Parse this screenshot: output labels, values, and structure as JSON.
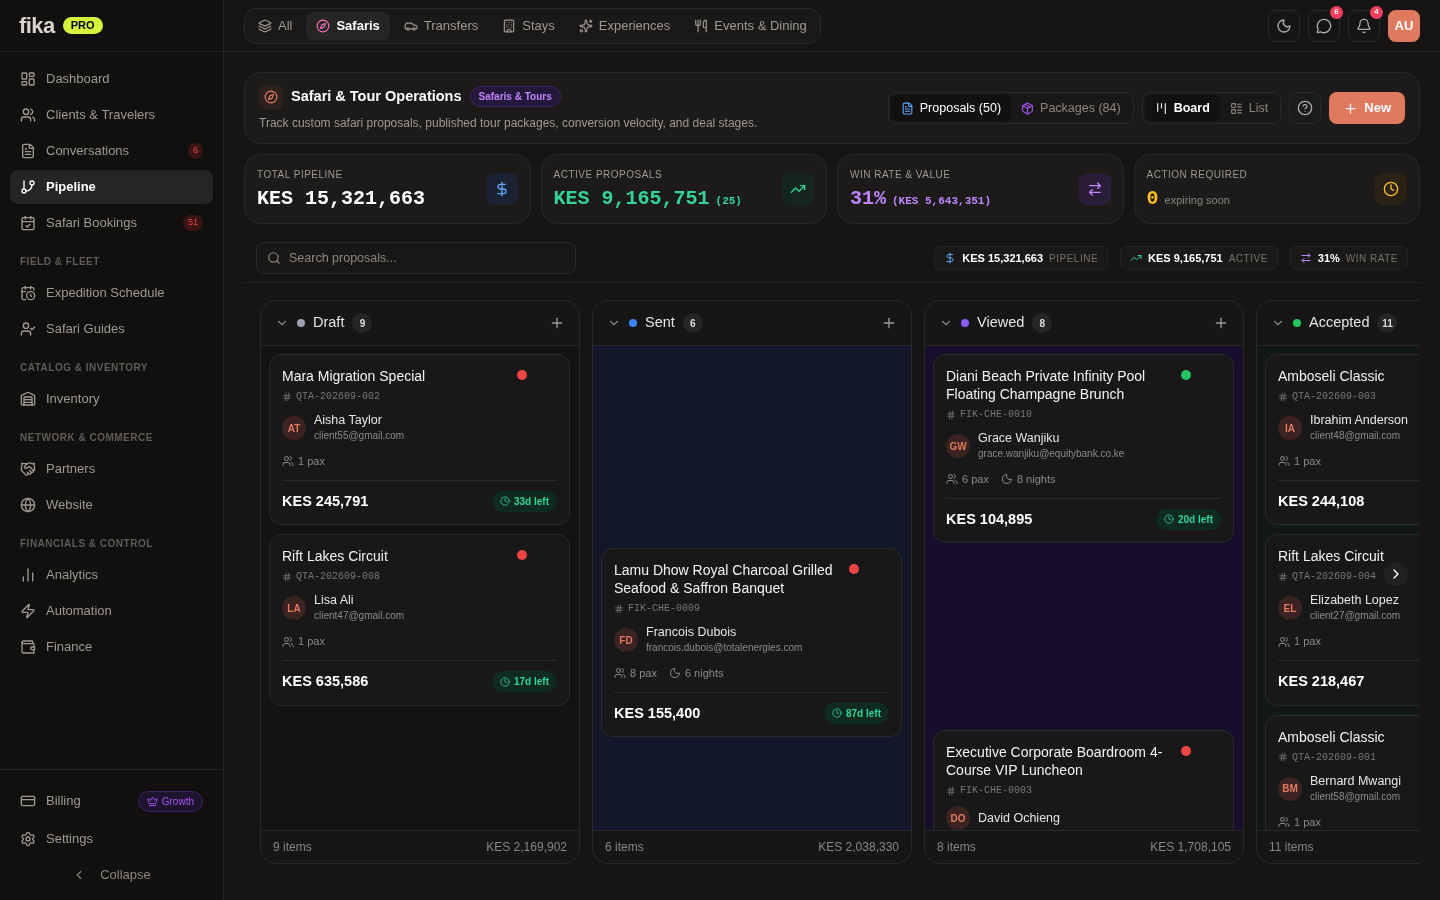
{
  "brand": {
    "name": "fika",
    "badge": "PRO"
  },
  "sidebar": {
    "groups": [
      {
        "items": [
          {
            "label": "Dashboard",
            "selected": false
          },
          {
            "label": "Clients & Travelers",
            "selected": false
          },
          {
            "label": "Conversations",
            "selected": false,
            "badge": "6"
          },
          {
            "label": "Pipeline",
            "selected": true
          },
          {
            "label": "Safari Bookings",
            "selected": false,
            "badge": "51"
          }
        ]
      },
      {
        "heading": "FIELD & FLEET",
        "items": [
          {
            "label": "Expedition Schedule",
            "selected": false
          },
          {
            "label": "Safari Guides",
            "selected": false
          }
        ]
      },
      {
        "heading": "CATALOG & INVENTORY",
        "items": [
          {
            "label": "Inventory",
            "selected": false
          }
        ]
      },
      {
        "heading": "NETWORK & COMMERCE",
        "items": [
          {
            "label": "Partners",
            "selected": false
          },
          {
            "label": "Website",
            "selected": false
          }
        ]
      },
      {
        "heading": "FINANCIALS & CONTROL",
        "items": [
          {
            "label": "Analytics",
            "selected": false
          },
          {
            "label": "Automation",
            "selected": false
          },
          {
            "label": "Finance",
            "selected": false
          }
        ]
      }
    ],
    "footer": {
      "billing": {
        "label": "Billing",
        "badge": "Growth"
      },
      "settings": "Settings",
      "collapse": "Collapse"
    }
  },
  "top_tabs": [
    {
      "label": "All",
      "selected": false
    },
    {
      "label": "Safaris",
      "selected": true
    },
    {
      "label": "Transfers",
      "selected": false
    },
    {
      "label": "Stays",
      "selected": false
    },
    {
      "label": "Experiences",
      "selected": false
    },
    {
      "label": "Events & Dining",
      "selected": false
    }
  ],
  "top_right": {
    "messages_badge": "6",
    "notifications_badge": "4",
    "avatar": "AU"
  },
  "header": {
    "title": "Safari & Tour Operations",
    "tag": "Safaris & Tours",
    "subtitle": "Track custom safari proposals, published tour packages, conversion velocity, and deal stages.",
    "sources": [
      {
        "label": "Proposals (50)",
        "selected": true
      },
      {
        "label": "Packages (84)",
        "selected": false
      }
    ],
    "views": [
      {
        "label": "Board",
        "selected": true
      },
      {
        "label": "List",
        "selected": false
      }
    ],
    "new_button": "New"
  },
  "stats": [
    {
      "label": "TOTAL PIPELINE",
      "value": "KES 15,321,663",
      "color": "#ffffff"
    },
    {
      "label": "ACTIVE PROPOSALS",
      "value": "KES 9,165,751",
      "extra": "(25)",
      "color": "#34d399"
    },
    {
      "label": "WIN RATE & VALUE",
      "value": "31%",
      "extra": "(KES 5,643,351)",
      "color": "#c084fc"
    },
    {
      "label": "ACTION REQUIRED",
      "value": "0",
      "note": "expiring soon",
      "color": "#fbbf24"
    }
  ],
  "search": {
    "placeholder": "Search proposals..."
  },
  "chips": [
    {
      "value": "KES 15,321,663",
      "label": "PIPELINE"
    },
    {
      "value": "KES 9,165,751",
      "label": "ACTIVE"
    },
    {
      "value": "31%",
      "label": "WIN RATE"
    }
  ],
  "columns": [
    {
      "title": "Draft",
      "count": "9",
      "color": "#9ca3af",
      "items_label": "9 items",
      "total": "KES 2,169,902",
      "cards": [
        {
          "title": "Mara Migration Special",
          "code": "QTA-202609-002",
          "initials": "AT",
          "name": "Aisha Taylor",
          "email": "client55@gmail.com",
          "pax": "1 pax",
          "amount": "KES 245,791",
          "due": "33d left",
          "color": "#ef4444"
        },
        {
          "title": "Rift Lakes Circuit",
          "code": "QTA-202609-008",
          "initials": "LA",
          "name": "Lisa Ali",
          "email": "client47@gmail.com",
          "pax": "1 pax",
          "amount": "KES 635,586",
          "due": "17d left",
          "color": "#ef4444"
        }
      ]
    },
    {
      "title": "Sent",
      "count": "6",
      "color": "#3b82f6",
      "items_label": "6 items",
      "total": "KES 2,038,330",
      "cards": [
        {
          "title": "Lamu Dhow Royal Charcoal Grilled Seafood & Saffron Banquet",
          "code": "FIK-CHE-0009",
          "initials": "FD",
          "name": "Francois Dubois",
          "email": "francois.dubois@totalenergies.com",
          "pax": "8 pax",
          "nights": "6 nights",
          "amount": "KES 155,400",
          "due": "87d left",
          "color": "#ef4444"
        }
      ]
    },
    {
      "title": "Viewed",
      "count": "8",
      "color": "#8b5cf6",
      "items_label": "8 items",
      "total": "KES 1,708,105",
      "cards": [
        {
          "title": "Diani Beach Private Infinity Pool Floating Champagne Brunch",
          "code": "FIK-CHE-0010",
          "initials": "GW",
          "name": "Grace Wanjiku",
          "email": "grace.wanjiku@equitybank.co.ke",
          "pax": "6 pax",
          "nights": "8 nights",
          "amount": "KES 104,895",
          "due": "20d left",
          "color": "#22c55e"
        },
        {
          "title": "Executive Corporate Boardroom 4-Course VIP Luncheon",
          "code": "FIK-CHE-0003",
          "initials": "DO",
          "name": "David Ochieng",
          "color": "#ef4444"
        }
      ]
    },
    {
      "title": "Accepted",
      "count": "11",
      "color": "#22c55e",
      "items_label": "11 items",
      "cards": [
        {
          "title": "Amboseli Classic",
          "code": "QTA-202609-003",
          "initials": "IA",
          "name": "Ibrahim Anderson",
          "email": "client48@gmail.com",
          "pax": "1 pax",
          "amount": "KES 244,108"
        },
        {
          "title": "Rift Lakes Circuit",
          "code": "QTA-202609-004",
          "initials": "EL",
          "name": "Elizabeth Lopez",
          "email": "client27@gmail.com",
          "pax": "1 pax",
          "amount": "KES 218,467"
        },
        {
          "title": "Amboseli Classic",
          "code": "QTA-202609-001",
          "initials": "BM",
          "name": "Bernard Mwangi",
          "email": "client58@gmail.com",
          "pax": "1 pax"
        }
      ]
    }
  ]
}
